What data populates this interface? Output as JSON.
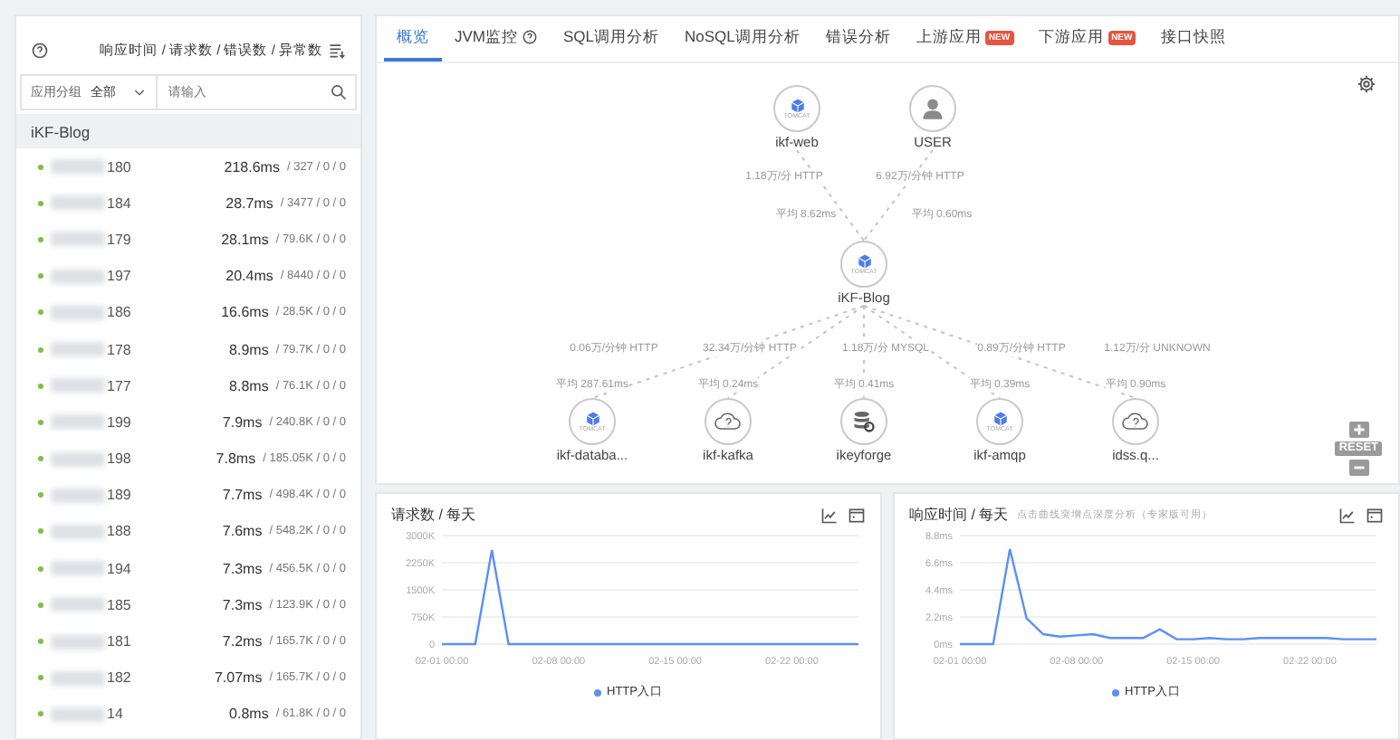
{
  "sidebar": {
    "header": {
      "metrics": "响应时间 / 请求数 / 错误数 / 异常数"
    },
    "filter": {
      "group_label": "应用分组",
      "group_value": "全部",
      "search_placeholder": "请输入"
    },
    "group": "iKF-Blog",
    "rows": [
      {
        "ip_suffix": "180",
        "latency": "218.6ms",
        "stats": "/ 327 / 0 / 0"
      },
      {
        "ip_suffix": "184",
        "latency": "28.7ms",
        "stats": "/ 3477 / 0 / 0"
      },
      {
        "ip_suffix": "179",
        "latency": "28.1ms",
        "stats": "/ 79.6K / 0 / 0"
      },
      {
        "ip_suffix": "197",
        "latency": "20.4ms",
        "stats": "/ 8440 / 0 / 0"
      },
      {
        "ip_suffix": "186",
        "latency": "16.6ms",
        "stats": "/ 28.5K / 0 / 0"
      },
      {
        "ip_suffix": "178",
        "latency": "8.9ms",
        "stats": "/ 79.7K / 0 / 0"
      },
      {
        "ip_suffix": "177",
        "latency": "8.8ms",
        "stats": "/ 76.1K / 0 / 0"
      },
      {
        "ip_suffix": "199",
        "latency": "7.9ms",
        "stats": "/ 240.8K / 0 / 0"
      },
      {
        "ip_suffix": "198",
        "latency": "7.8ms",
        "stats": "/ 185.05K / 0 / 0"
      },
      {
        "ip_suffix": "189",
        "latency": "7.7ms",
        "stats": "/ 498.4K / 0 / 0"
      },
      {
        "ip_suffix": "188",
        "latency": "7.6ms",
        "stats": "/ 548.2K / 0 / 0"
      },
      {
        "ip_suffix": "194",
        "latency": "7.3ms",
        "stats": "/ 456.5K / 0 / 0"
      },
      {
        "ip_suffix": "185",
        "latency": "7.3ms",
        "stats": "/ 123.9K / 0 / 0"
      },
      {
        "ip_suffix": "181",
        "latency": "7.2ms",
        "stats": "/ 165.7K / 0 / 0"
      },
      {
        "ip_suffix": "182",
        "latency": "7.07ms",
        "stats": "/ 165.7K / 0 / 0"
      },
      {
        "ip_suffix": "14",
        "latency": "0.8ms",
        "stats": "/ 61.8K / 0 / 0"
      }
    ]
  },
  "tabs": [
    {
      "label": "概览",
      "selected": true
    },
    {
      "label": "JVM监控",
      "selected": false,
      "help": true
    },
    {
      "label": "SQL调用分析",
      "selected": false
    },
    {
      "label": "NoSQL调用分析",
      "selected": false
    },
    {
      "label": "错误分析",
      "selected": false
    },
    {
      "label": "上游应用",
      "selected": false,
      "badge": "NEW"
    },
    {
      "label": "下游应用",
      "selected": false,
      "badge": "NEW"
    },
    {
      "label": "接口快照",
      "selected": false
    }
  ],
  "topology": {
    "nodes": [
      {
        "kind": "tomcat",
        "label": "ikf-web",
        "badge": "TOMCAT"
      },
      {
        "kind": "user",
        "label": "USER"
      },
      {
        "kind": "tomcat",
        "label": "iKF-Blog",
        "badge": "TOMCAT"
      },
      {
        "kind": "tomcat",
        "label": "ikf-databa...",
        "badge": "TOMCAT"
      },
      {
        "kind": "cloud",
        "label": "ikf-kafka"
      },
      {
        "kind": "database",
        "label": "ikeyforge"
      },
      {
        "kind": "tomcat",
        "label": "ikf-amqp",
        "badge": "TOMCAT"
      },
      {
        "kind": "cloud",
        "label": "idss.q..."
      }
    ],
    "edges": [
      {
        "rate": "1.18万/分 HTTP",
        "avg": "平均 8.62ms"
      },
      {
        "rate": "6.92万/分钟 HTTP",
        "avg": "平均 0.60ms"
      },
      {
        "rate": "0.06万/分钟 HTTP",
        "avg": "平均 287.61ms"
      },
      {
        "rate": "32.34万/分钟 HTTP",
        "avg": "平均 0.24ms"
      },
      {
        "rate": "1.18万/分 MYSQL",
        "avg": "平均 0.41ms"
      },
      {
        "rate": "0.89万/分钟 HTTP",
        "avg": "平均 0.39ms"
      },
      {
        "rate": "1.12万/分 UNKNOWN",
        "avg": "平均 0.90ms"
      }
    ],
    "zoom": {
      "reset": "RESET"
    }
  },
  "charts": [
    {
      "title": "请求数 / 每天",
      "chart_data": {
        "type": "line",
        "grid": true,
        "categories": [
          "02-01 00:00",
          null,
          null,
          null,
          null,
          null,
          null,
          "02-08 00:00",
          null,
          null,
          null,
          null,
          null,
          null,
          "02-15 00:00",
          null,
          null,
          null,
          null,
          null,
          null,
          "02-22 00:00",
          null,
          null,
          null,
          null
        ],
        "ylim": [
          0,
          3000
        ],
        "yticks": [
          {
            "value": 0,
            "label": "0"
          },
          {
            "value": 750,
            "label": "750K"
          },
          {
            "value": 1500,
            "label": "1500K"
          },
          {
            "value": 2250,
            "label": "2250K"
          },
          {
            "value": 3000,
            "label": "3000K"
          }
        ],
        "series": [
          {
            "name": "HTTP入口",
            "color": "#5b8ff9",
            "values": [
              0,
              0,
              0,
              2600,
              0,
              0,
              0,
              0,
              0,
              0,
              0,
              0,
              0,
              0,
              0,
              0,
              0,
              0,
              0,
              0,
              0,
              0,
              0,
              0,
              0,
              0
            ]
          }
        ]
      }
    },
    {
      "title": "响应时间 / 每天",
      "subtitle": "点击曲线突增点深度分析（专家版可用）",
      "chart_data": {
        "type": "line",
        "grid": true,
        "categories": [
          "02-01 00:00",
          null,
          null,
          null,
          null,
          null,
          null,
          "02-08 00:00",
          null,
          null,
          null,
          null,
          null,
          null,
          "02-15 00:00",
          null,
          null,
          null,
          null,
          null,
          null,
          "02-22 00:00",
          null,
          null,
          null,
          null
        ],
        "ylim": [
          0,
          8.8
        ],
        "yticks": [
          {
            "value": 0,
            "label": "0ms"
          },
          {
            "value": 2.2,
            "label": "2.2ms"
          },
          {
            "value": 4.4,
            "label": "4.4ms"
          },
          {
            "value": 6.6,
            "label": "6.6ms"
          },
          {
            "value": 8.8,
            "label": "8.8ms"
          }
        ],
        "series": [
          {
            "name": "HTTP入口",
            "color": "#5b8ff9",
            "values": [
              0,
              0,
              0,
              7.7,
              2.1,
              0.8,
              0.6,
              0.7,
              0.8,
              0.5,
              0.5,
              0.5,
              1.2,
              0.4,
              0.4,
              0.5,
              0.4,
              0.4,
              0.5,
              0.5,
              0.5,
              0.5,
              0.5,
              0.4,
              0.4,
              0.4
            ]
          }
        ]
      }
    }
  ]
}
